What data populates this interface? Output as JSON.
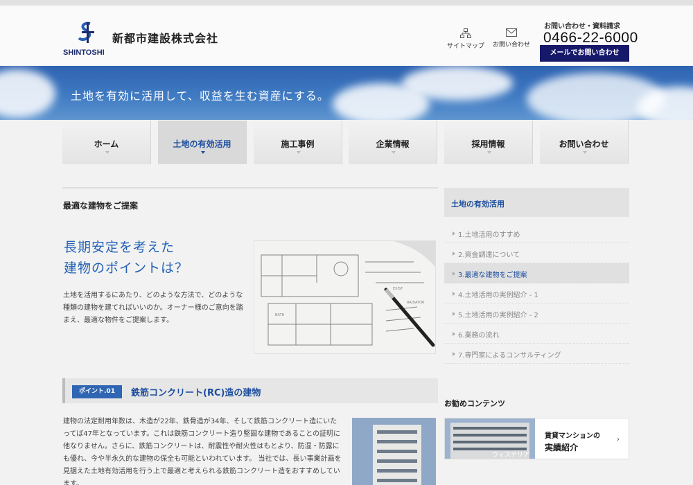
{
  "header": {
    "logo_text": "SHINTOSHI",
    "company_name": "新都市建設株式会社",
    "sitemap_label": "サイトマップ",
    "contact_label": "お問い合わせ",
    "contact_heading": "お問い合わせ・資料請求",
    "phone": "0466-22-6000",
    "mail_button": "メールでお問い合わせ"
  },
  "hero": {
    "tagline": "土地を有効に活用して、収益を生む資産にする。"
  },
  "nav": {
    "items": [
      {
        "label": "ホーム"
      },
      {
        "label": "土地の有効活用"
      },
      {
        "label": "施工事例"
      },
      {
        "label": "企業情報"
      },
      {
        "label": "採用情報"
      },
      {
        "label": "お問い合わせ"
      }
    ],
    "active_index": 1
  },
  "main": {
    "page_heading": "最適な建物をご提案",
    "lead_title_line1": "長期安定を考えた",
    "lead_title_line2": "建物のポイントは？",
    "lead_body": "土地を活用するにあたり、どのような方法で、どのような種類の建物を建てればいいのか。オーナー様のご意向を踏まえ、最適な物件をご提案します。",
    "point_badge": "ポイント.01",
    "point_title": "鉄筋コンクリート(RC)造の建物",
    "point_body": "建物の法定耐用年数は、木造が22年、鉄骨造が34年、そして鉄筋コンクリート造にいたってば47年となっています。これは鉄筋コンクリート造り堅固な建物であることの証明に他なりません。さらに、鉄筋コンクリートは、耐震性や耐火性はもとより、防湿・防露にも優れ、今や半永久的な建物の保全も可能といわれています。 当社では、長い事業計画を見据えた土地有効活用を行う上で最適と考えられる鉄筋コンクリート造をおすすめしています。"
  },
  "sidebar": {
    "heading": "土地の有効活用",
    "items": [
      {
        "label": "1.土地活用のすすめ"
      },
      {
        "label": "2.資金調達について"
      },
      {
        "label": "3.最適な建物をご提案"
      },
      {
        "label": "4.土地活用の実例紹介 - 1"
      },
      {
        "label": "5.土地活用の実例紹介 - 2"
      },
      {
        "label": "6.業務の流れ"
      },
      {
        "label": "7.専門家によるコンサルティング"
      }
    ],
    "active_index": 2,
    "recommend_heading": "お勧めコンテンツ",
    "recommend_card": {
      "caption": "ウィステリア湘南",
      "line1": "賃貸マンションの",
      "line2": "実績紹介",
      "chevron": "›"
    }
  },
  "colors": {
    "accent": "#1c4d9e",
    "navy": "#16196a",
    "hero_blue": "#3f7ac2"
  }
}
